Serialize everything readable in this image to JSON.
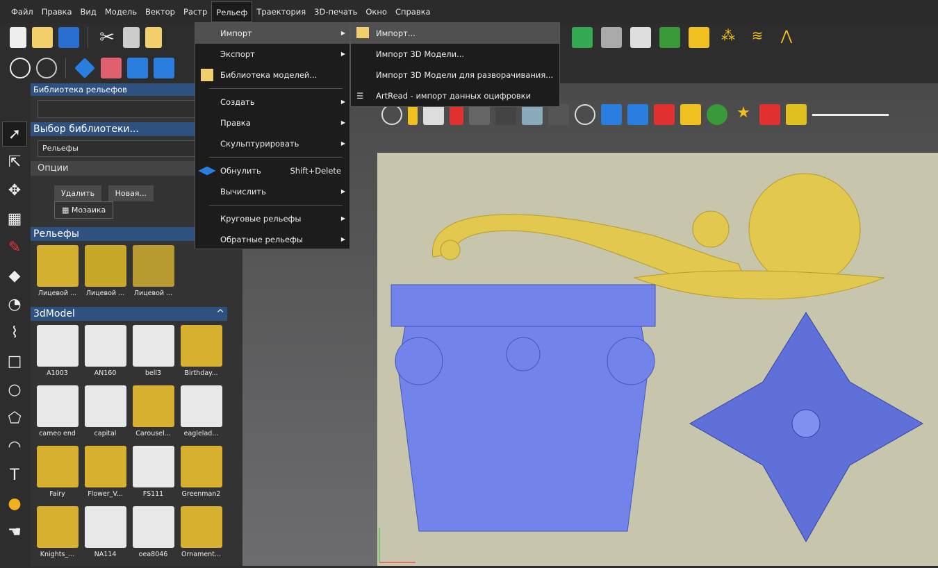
{
  "menubar": [
    "Файл",
    "Правка",
    "Вид",
    "Модель",
    "Вектор",
    "Растр",
    "Рельеф",
    "Траектория",
    "3D-печать",
    "Окно",
    "Справка"
  ],
  "active_menu": "Рельеф",
  "panel": {
    "title": "Библиотека рельефов",
    "library_header": "Выбор библиотеки...",
    "library_value": "Рельефы",
    "options": "Опции",
    "buttons": {
      "delete": "Удалить",
      "new": "Новая...",
      "mosaic": "Мозаика"
    },
    "reliefs_header": "Рельефы",
    "reliefs": [
      "Лицевой ...",
      "Лицевой ...",
      "Лицевой ..."
    ],
    "models_header": "3dModel",
    "models": [
      "A1003",
      "AN160",
      "bell3",
      "Birthday...",
      "cameo end",
      "capital",
      "Carousel...",
      "eaglelad...",
      "Fairy",
      "Flower_V...",
      "FS111",
      "Greenman2",
      "Knights_...",
      "NA114",
      "oea8046",
      "Ornament..."
    ]
  },
  "menu": {
    "items": [
      {
        "label": "Импорт",
        "submenu": true
      },
      {
        "label": "Экспорт",
        "submenu": true
      },
      {
        "label": "Библиотека моделей...",
        "icon": "folder-star-icon"
      },
      {
        "label": "Создать",
        "submenu": true
      },
      {
        "label": "Правка",
        "submenu": true
      },
      {
        "label": "Скульптурировать",
        "submenu": true
      },
      {
        "label": "Обнулить",
        "shortcut": "Shift+Delete",
        "icon": "diamond-icon"
      },
      {
        "label": "Вычислить",
        "submenu": true
      },
      {
        "label": "Круговые рельефы",
        "submenu": true
      },
      {
        "label": "Обратные рельефы",
        "submenu": true
      }
    ]
  },
  "submenu": {
    "items": [
      "Импорт...",
      "Импорт 3D Модели...",
      "Импорт 3D Модели для разворачивания...",
      "ArtRead - импорт данных оцифровки"
    ]
  },
  "colors": {
    "accent": "#2f5180",
    "gold": "#e0c040",
    "blue": "#6f80e8",
    "canvas": "#c7c6ac"
  }
}
